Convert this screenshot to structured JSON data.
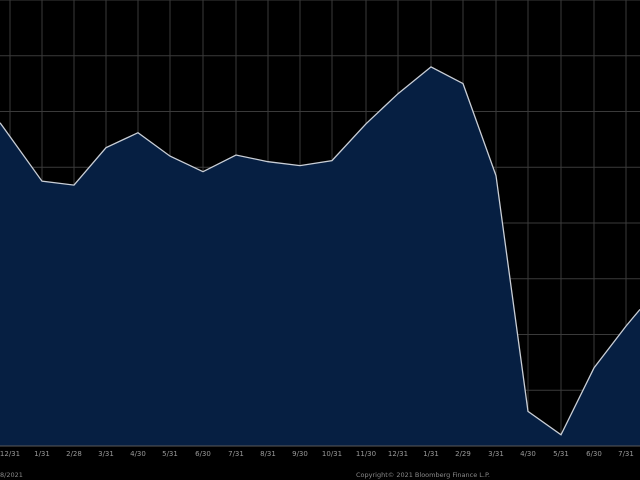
{
  "chart_data": {
    "type": "area",
    "categories": [
      "12/31",
      "1/31",
      "2/28",
      "3/31",
      "4/30",
      "5/31",
      "6/30",
      "7/31",
      "8/31",
      "9/30",
      "10/31",
      "11/30",
      "12/31",
      "1/31",
      "2/29",
      "3/31",
      "4/30",
      "5/31",
      "6/30",
      "7/31"
    ],
    "x_positions": [
      10,
      42,
      74,
      106,
      138,
      170,
      203,
      236,
      268,
      300,
      332,
      366,
      398,
      431,
      463,
      496,
      528,
      561,
      594,
      626
    ],
    "series": [
      {
        "x": [
          0,
          10,
          42,
          74,
          106,
          138,
          170,
          203,
          236,
          268,
          300,
          332,
          366,
          398,
          431,
          463,
          496,
          528,
          561,
          594,
          626,
          640
        ],
        "values": [
          2.8,
          2.55,
          1.75,
          1.68,
          2.35,
          2.62,
          2.2,
          1.92,
          2.22,
          2.1,
          2.03,
          2.12,
          2.78,
          3.32,
          3.8,
          3.5,
          1.85,
          -2.38,
          -2.8,
          -1.6,
          -0.85,
          -0.55
        ]
      }
    ],
    "ylim": [
      -3.0,
      5.0
    ],
    "xlim": [
      0,
      640
    ],
    "grid": true,
    "colors": {
      "fill": "#061f42",
      "line": "#c9ced6",
      "grid": "#3a3a3a",
      "background": "#000000"
    }
  },
  "footer": {
    "left": "8/2021",
    "right": "Copyright© 2021 Bloomberg Finance L.P."
  }
}
